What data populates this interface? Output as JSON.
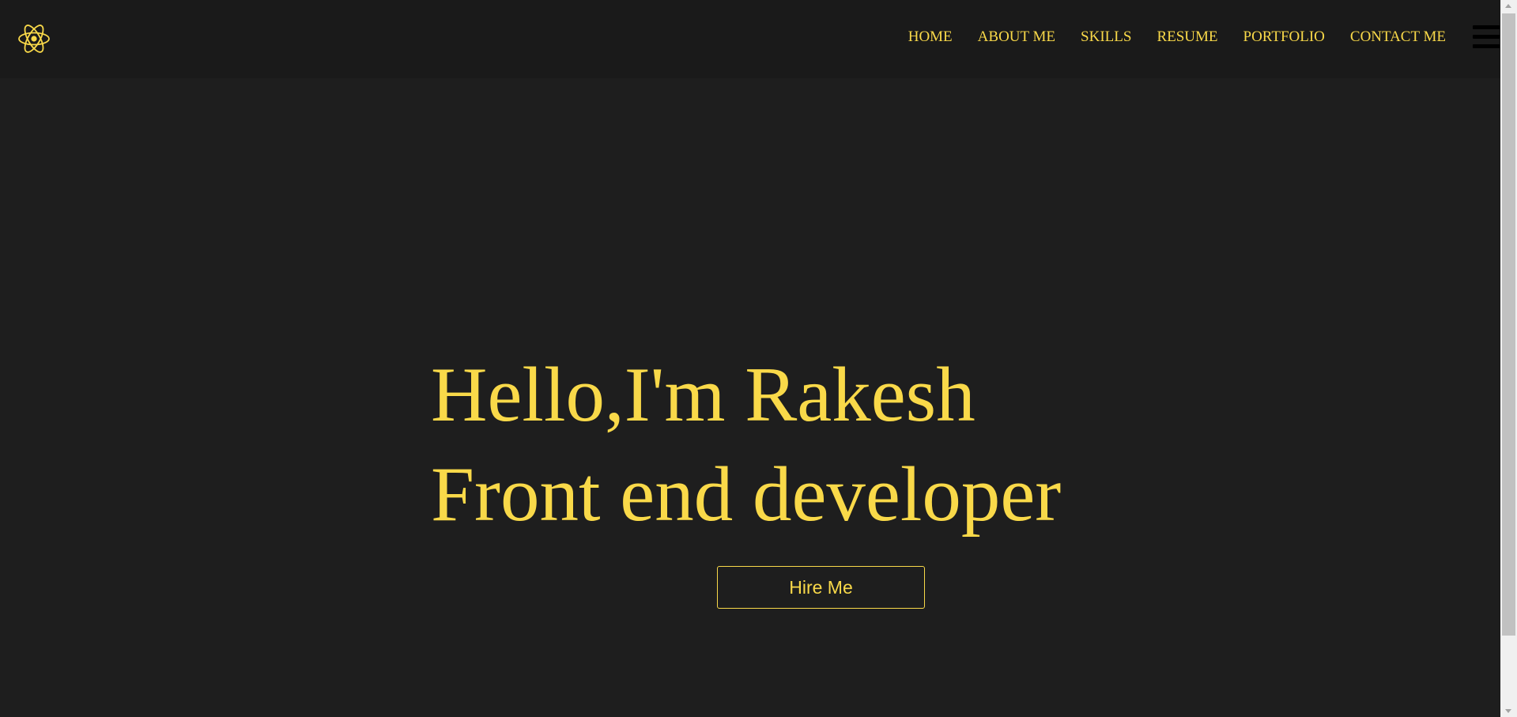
{
  "brand": {
    "logo_icon": "atom-icon",
    "accent_color": "#f9d949",
    "background_color": "#1e1e1e",
    "navbar_color": "#1a1a1a"
  },
  "nav": {
    "items": [
      {
        "label": "HOME"
      },
      {
        "label": "ABOUT ME"
      },
      {
        "label": "SKILLS"
      },
      {
        "label": "RESUME"
      },
      {
        "label": "PORTFOLIO"
      },
      {
        "label": "CONTACT ME"
      }
    ],
    "menu_icon": "hamburger-menu-icon"
  },
  "hero": {
    "greeting": "Hello,I'm Rakesh",
    "role": "Front end developer",
    "cta_label": "Hire Me"
  }
}
